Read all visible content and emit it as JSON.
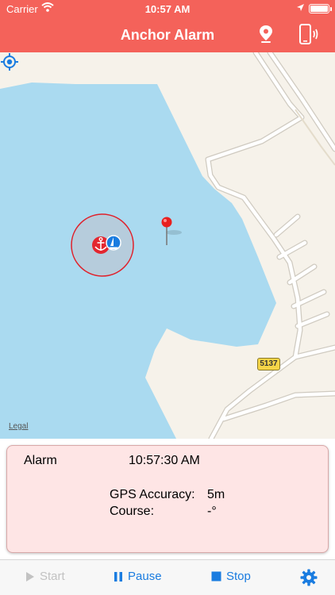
{
  "status_bar": {
    "carrier": "Carrier",
    "time": "10:57 AM"
  },
  "nav": {
    "title": "Anchor Alarm"
  },
  "map": {
    "road_number": "5137",
    "legal_label": "Legal"
  },
  "alarm_panel": {
    "alarm_label": "Alarm",
    "alarm_time": "10:57:30 AM",
    "gps_accuracy_label": "GPS Accuracy:",
    "gps_accuracy_value": "5m",
    "course_label": "Course:",
    "course_value": "-°"
  },
  "toolbar": {
    "start_label": "Start",
    "pause_label": "Pause",
    "stop_label": "Stop"
  },
  "colors": {
    "header": "#f4625a",
    "water": "#aadaf0",
    "land": "#f6f2ea",
    "accent": "#1a7ce0",
    "panel": "#fee5e5"
  }
}
